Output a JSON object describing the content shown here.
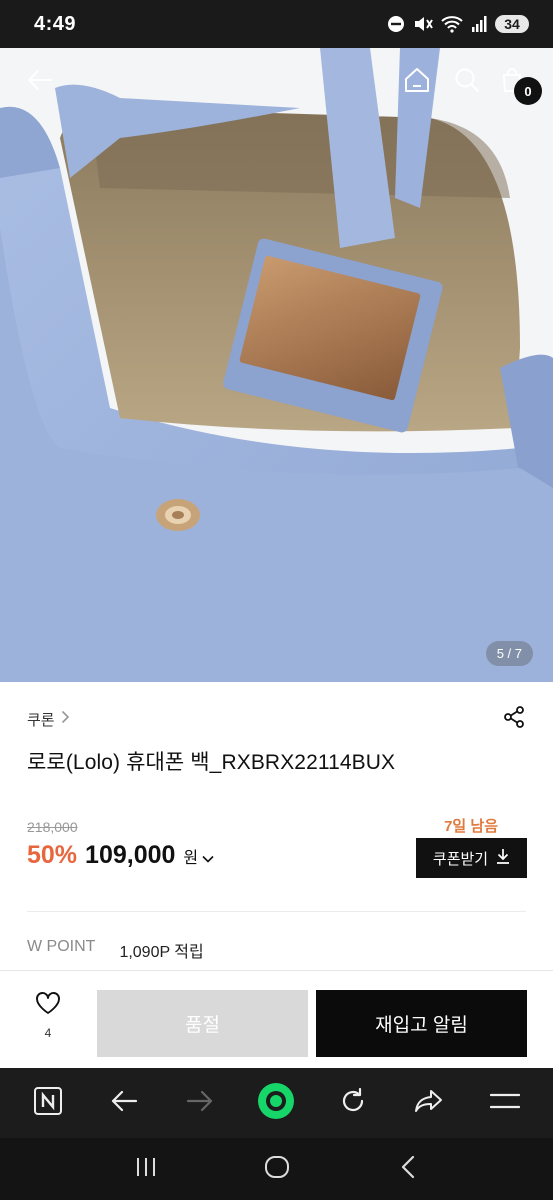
{
  "status_bar": {
    "time": "4:49",
    "battery": "34",
    "icons": [
      "do-not-disturb-icon",
      "mute-icon",
      "wifi-icon",
      "signal-icon"
    ]
  },
  "hero": {
    "pager": "5 / 7",
    "cart_count": "0",
    "icons": [
      "back-arrow-icon",
      "home-icon",
      "search-icon",
      "shopping-bag-icon"
    ]
  },
  "product": {
    "brand": "쿠론",
    "title": "로로(Lolo) 휴대폰 백_RXBRX22114BUX",
    "original_price": "218,000",
    "days_left": "7일 남음",
    "discount": "50%",
    "sale_price": "109,000",
    "currency": "원",
    "coupon_label": "쿠폰받기"
  },
  "points": {
    "label": "W POINT",
    "value": "1,090P 적립"
  },
  "actions": {
    "like_count": "4",
    "soldout_label": "품절",
    "restock_label": "재입고 알림"
  },
  "colors": {
    "accent_orange": "#e8663d",
    "bag_blue": "#9db3dc",
    "dark": "#111111"
  }
}
